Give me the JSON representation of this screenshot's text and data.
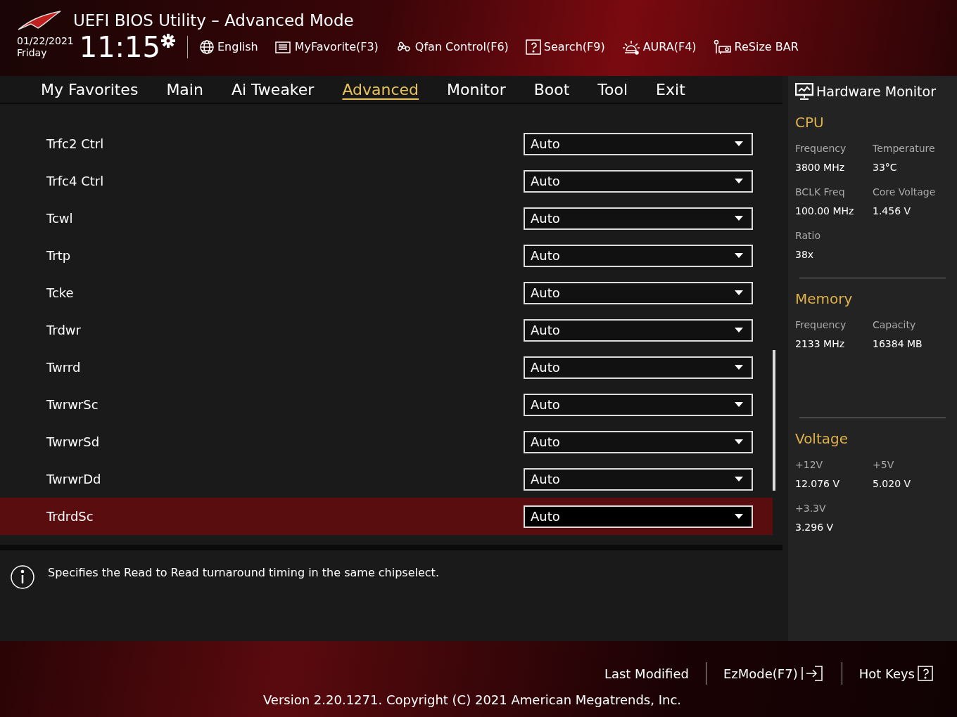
{
  "window": {
    "title": "UEFI BIOS Utility – Advanced Mode"
  },
  "clock": {
    "date": "01/22/2021",
    "day": "Friday",
    "time": "11:15"
  },
  "toolbar": [
    {
      "kind": "globe",
      "label": "English"
    },
    {
      "kind": "list",
      "label": "MyFavorite(F3)"
    },
    {
      "kind": "fan",
      "label": "Qfan Control(F6)"
    },
    {
      "kind": "help",
      "label": "Search(F9)"
    },
    {
      "kind": "light",
      "label": "AURA(F4)"
    },
    {
      "kind": "card",
      "label": "ReSize BAR"
    }
  ],
  "tabs": [
    {
      "label": "My Favorites",
      "selected": false
    },
    {
      "label": "Main",
      "selected": false
    },
    {
      "label": "Ai Tweaker",
      "selected": false
    },
    {
      "label": "Advanced",
      "selected": true
    },
    {
      "label": "Monitor",
      "selected": false
    },
    {
      "label": "Boot",
      "selected": false
    },
    {
      "label": "Tool",
      "selected": false
    },
    {
      "label": "Exit",
      "selected": false
    }
  ],
  "settings": [
    {
      "label": "Trfc2 Ctrl",
      "value": "Auto",
      "selected": false
    },
    {
      "label": "Trfc4 Ctrl",
      "value": "Auto",
      "selected": false
    },
    {
      "label": "Tcwl",
      "value": "Auto",
      "selected": false
    },
    {
      "label": "Trtp",
      "value": "Auto",
      "selected": false
    },
    {
      "label": "Tcke",
      "value": "Auto",
      "selected": false
    },
    {
      "label": "Trdwr",
      "value": "Auto",
      "selected": false
    },
    {
      "label": "Twrrd",
      "value": "Auto",
      "selected": false
    },
    {
      "label": "TwrwrSc",
      "value": "Auto",
      "selected": false
    },
    {
      "label": "TwrwrSd",
      "value": "Auto",
      "selected": false
    },
    {
      "label": "TwrwrDd",
      "value": "Auto",
      "selected": false
    },
    {
      "label": "TrdrdSc",
      "value": "Auto",
      "selected": true
    }
  ],
  "description": "Specifies the Read to Read turnaround timing in the same chipselect.",
  "hardware_monitor": {
    "title": "Hardware Monitor",
    "sections": [
      {
        "title": "CPU",
        "items": [
          {
            "label": "Frequency",
            "value": "3800 MHz"
          },
          {
            "label": "Temperature",
            "value": "33°C"
          },
          {
            "label": "BCLK Freq",
            "value": "100.00 MHz"
          },
          {
            "label": "Core Voltage",
            "value": "1.456 V"
          },
          {
            "label": "Ratio",
            "value": "38x"
          }
        ]
      },
      {
        "title": "Memory",
        "items": [
          {
            "label": "Frequency",
            "value": "2133 MHz"
          },
          {
            "label": "Capacity",
            "value": "16384 MB"
          }
        ]
      },
      {
        "title": "Voltage",
        "items": [
          {
            "label": "+12V",
            "value": "12.076 V"
          },
          {
            "label": "+5V",
            "value": "5.020 V"
          },
          {
            "label": "+3.3V",
            "value": "3.296 V"
          }
        ]
      }
    ]
  },
  "footer": {
    "buttons": [
      {
        "kind": "plain",
        "label": "Last Modified"
      },
      {
        "kind": "exit",
        "label": "EzMode(F7)"
      },
      {
        "kind": "help",
        "label": "Hot Keys"
      }
    ],
    "version": "Version 2.20.1271. Copyright (C) 2021 American Megatrends, Inc."
  }
}
